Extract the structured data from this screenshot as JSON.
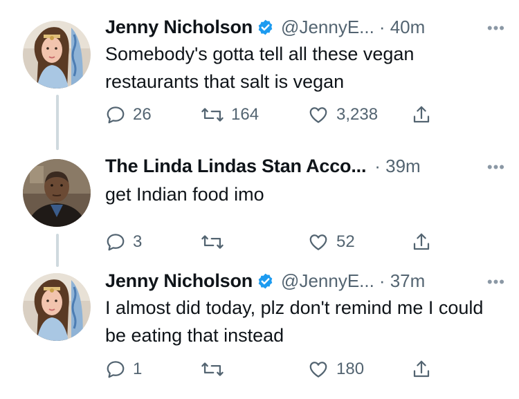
{
  "colors": {
    "verified": "#1d9bf0",
    "text": "#0f1419",
    "secondary": "#536471",
    "thread_line": "#cfd9de"
  },
  "tweets": [
    {
      "name": "Jenny Nicholson",
      "verified": true,
      "handle": "@JennyE...",
      "time": "· 40m",
      "more": "•••",
      "text": "Somebody's gotta tell all these vegan restaurants that salt is vegan",
      "replies": "26",
      "retweets": "164",
      "likes": "3,238"
    },
    {
      "name": "The Linda Lindas Stan Acco...",
      "verified": false,
      "handle": "",
      "time": "· 39m",
      "more": "•••",
      "text": "get Indian food imo",
      "replies": "3",
      "retweets": "",
      "likes": "52"
    },
    {
      "name": "Jenny Nicholson",
      "verified": true,
      "handle": "@JennyE...",
      "time": "· 37m",
      "more": "•••",
      "text": "I almost did today, plz don't remind me I could be eating that instead",
      "replies": "1",
      "retweets": "",
      "likes": "180"
    }
  ]
}
